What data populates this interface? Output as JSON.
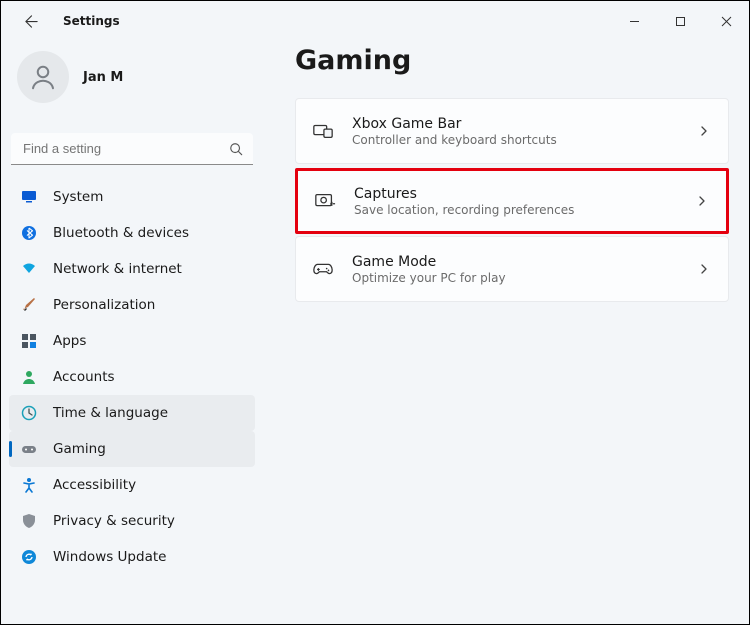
{
  "window": {
    "title": "Settings"
  },
  "user": {
    "name": "Jan M"
  },
  "search": {
    "placeholder": "Find a setting"
  },
  "nav": {
    "items": [
      {
        "label": "System"
      },
      {
        "label": "Bluetooth & devices"
      },
      {
        "label": "Network & internet"
      },
      {
        "label": "Personalization"
      },
      {
        "label": "Apps"
      },
      {
        "label": "Accounts"
      },
      {
        "label": "Time & language"
      },
      {
        "label": "Gaming"
      },
      {
        "label": "Accessibility"
      },
      {
        "label": "Privacy & security"
      },
      {
        "label": "Windows Update"
      }
    ]
  },
  "page": {
    "title": "Gaming"
  },
  "cards": [
    {
      "title": "Xbox Game Bar",
      "sub": "Controller and keyboard shortcuts"
    },
    {
      "title": "Captures",
      "sub": "Save location, recording preferences"
    },
    {
      "title": "Game Mode",
      "sub": "Optimize your PC for play"
    }
  ]
}
